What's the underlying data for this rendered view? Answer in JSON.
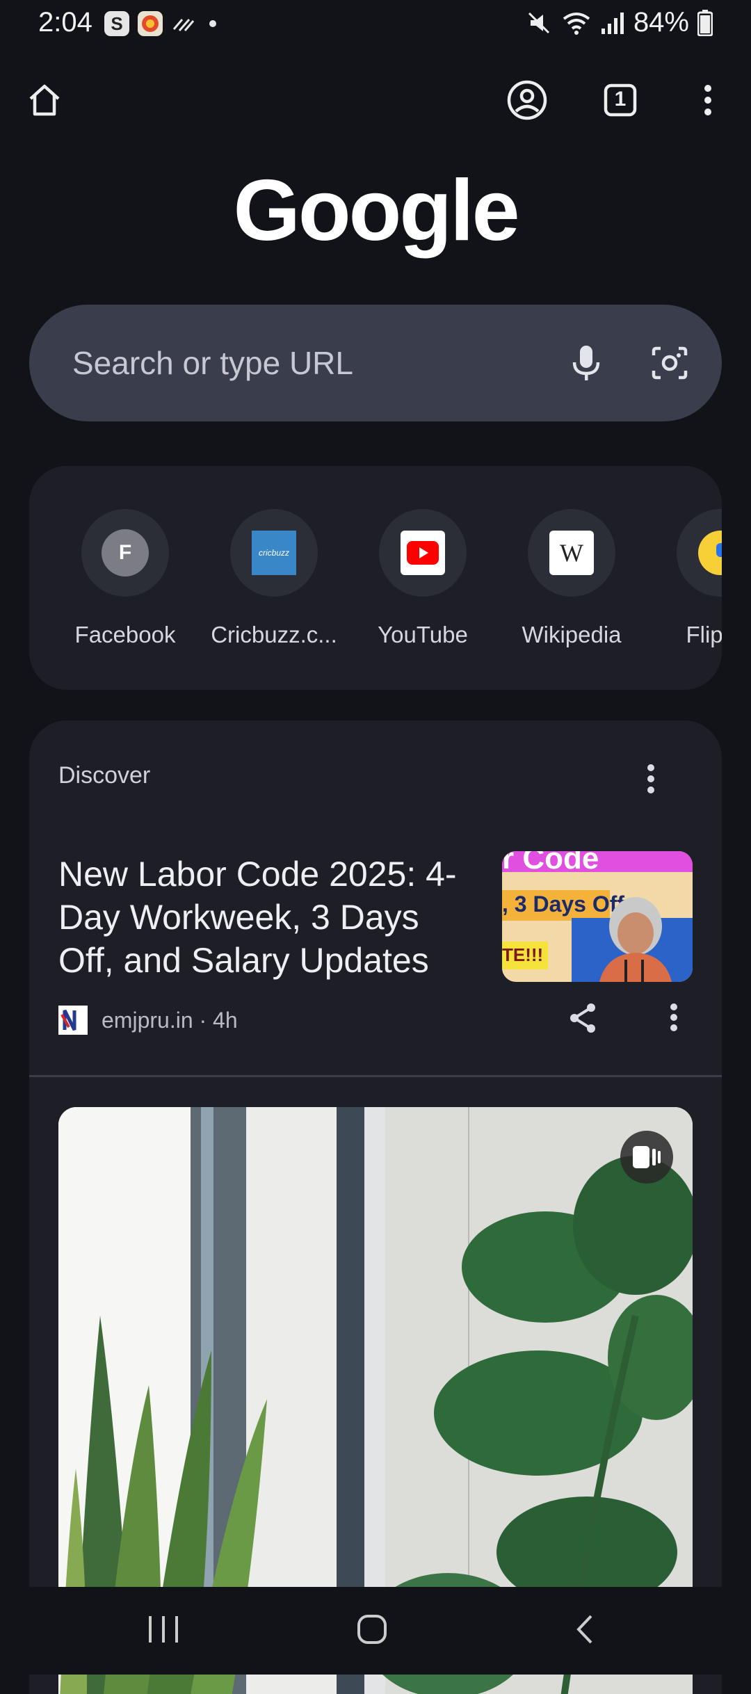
{
  "status_bar": {
    "time": "2:04",
    "battery": "84%",
    "notification_icons": [
      "s-app-icon",
      "game-app-icon",
      "wind-icon",
      "dot-icon"
    ],
    "system_icons": [
      "mute-icon",
      "wifi-icon",
      "signal-icon",
      "battery-icon"
    ]
  },
  "toolbar": {
    "tab_count": "1",
    "icons": [
      "home-icon",
      "account-icon",
      "tab-switcher-icon",
      "more-vert-icon"
    ]
  },
  "logo": {
    "text": "Google"
  },
  "search": {
    "placeholder": "Search or type URL",
    "icons": [
      "mic-icon",
      "lens-icon"
    ]
  },
  "shortcuts": [
    {
      "label": "Facebook",
      "initial": "F",
      "icon": "facebook-favicon"
    },
    {
      "label": "Cricbuzz.c...",
      "icon": "cricbuzz-favicon",
      "favicon_text": "cricbuzz"
    },
    {
      "label": "YouTube",
      "icon": "youtube-favicon"
    },
    {
      "label": "Wikipedia",
      "icon": "wikipedia-favicon",
      "favicon_text": "W"
    },
    {
      "label": "Flipkar",
      "icon": "flipkart-favicon"
    }
  ],
  "discover": {
    "title": "Discover",
    "article": {
      "headline": "New Labor Code 2025: 4-Day Workweek, 3 Days Off, and Salary Updates",
      "source": "emjpru.in · 4h",
      "thumb_text_1": "r Code",
      "thumb_text_2": ", 3 Days Off",
      "thumb_text_3": "TE!!!"
    }
  },
  "colors": {
    "background": "#121318",
    "card": "#1e1f26",
    "search_bar": "#3a3d4b",
    "text_primary": "#eeeef3"
  }
}
